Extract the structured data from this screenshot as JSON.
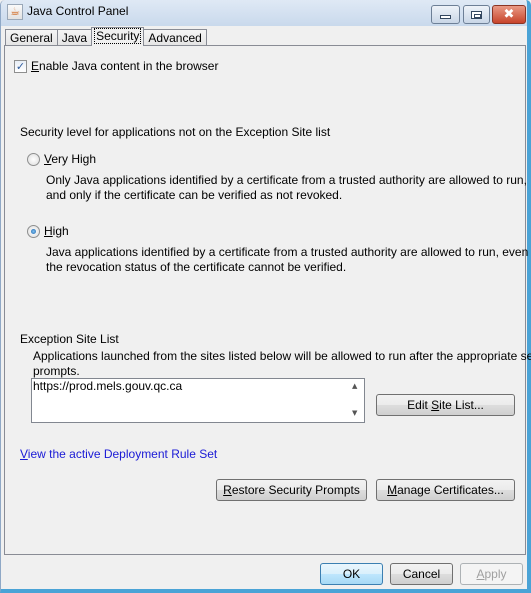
{
  "window": {
    "title": "Java Control Panel",
    "icon": "java-coffee-icon",
    "controls": {
      "minimize": "minimize-icon",
      "maximize": "maximize-icon",
      "close": "close-icon"
    }
  },
  "tabs": [
    {
      "label": "General",
      "active": false
    },
    {
      "label": "Java",
      "active": false
    },
    {
      "label": "Security",
      "active": true
    },
    {
      "label": "Advanced",
      "active": false
    }
  ],
  "security": {
    "enable_java": {
      "label_mnemonic": "E",
      "label_rest": "nable Java content in the browser",
      "checked": true
    },
    "level_heading": "Security level for applications not on the Exception Site list",
    "levels": [
      {
        "label_mnemonic": "V",
        "label_rest": "ery High",
        "selected": false,
        "description_line1": "Only Java applications identified by a certificate from a trusted authority are allowed to run,",
        "description_line2": "and only if the certificate can be verified as not revoked."
      },
      {
        "label_mnemonic": "H",
        "label_rest": "igh",
        "selected": true,
        "description_line1": "Java applications identified by a certificate from a trusted authority are allowed to run, even if",
        "description_line2": "the revocation status of the certificate cannot be verified."
      }
    ],
    "exception_site_list": {
      "heading": "Exception Site List",
      "description_line1": "Applications launched from the sites listed below will be allowed to run after the appropriate security",
      "description_line2": "prompts.",
      "sites": [
        "https://prod.mels.gouv.qc.ca"
      ],
      "edit_button": {
        "pre": "Edit ",
        "mnemonic": "S",
        "post": "ite List..."
      }
    },
    "deployment_link": {
      "mnemonic": "V",
      "rest": "iew the active Deployment Rule Set"
    },
    "restore_button": {
      "mnemonic": "R",
      "rest": "estore Security Prompts"
    },
    "manage_button": {
      "mnemonic": "M",
      "rest": "anage Certificates..."
    }
  },
  "footer": {
    "ok": "OK",
    "cancel": "Cancel",
    "apply_mnemonic": "A",
    "apply_rest": "pply",
    "apply_enabled": false
  },
  "colors": {
    "link": "#1a1ad6",
    "window_frame": "#4aa3d6",
    "close_button": "#c7442b"
  }
}
